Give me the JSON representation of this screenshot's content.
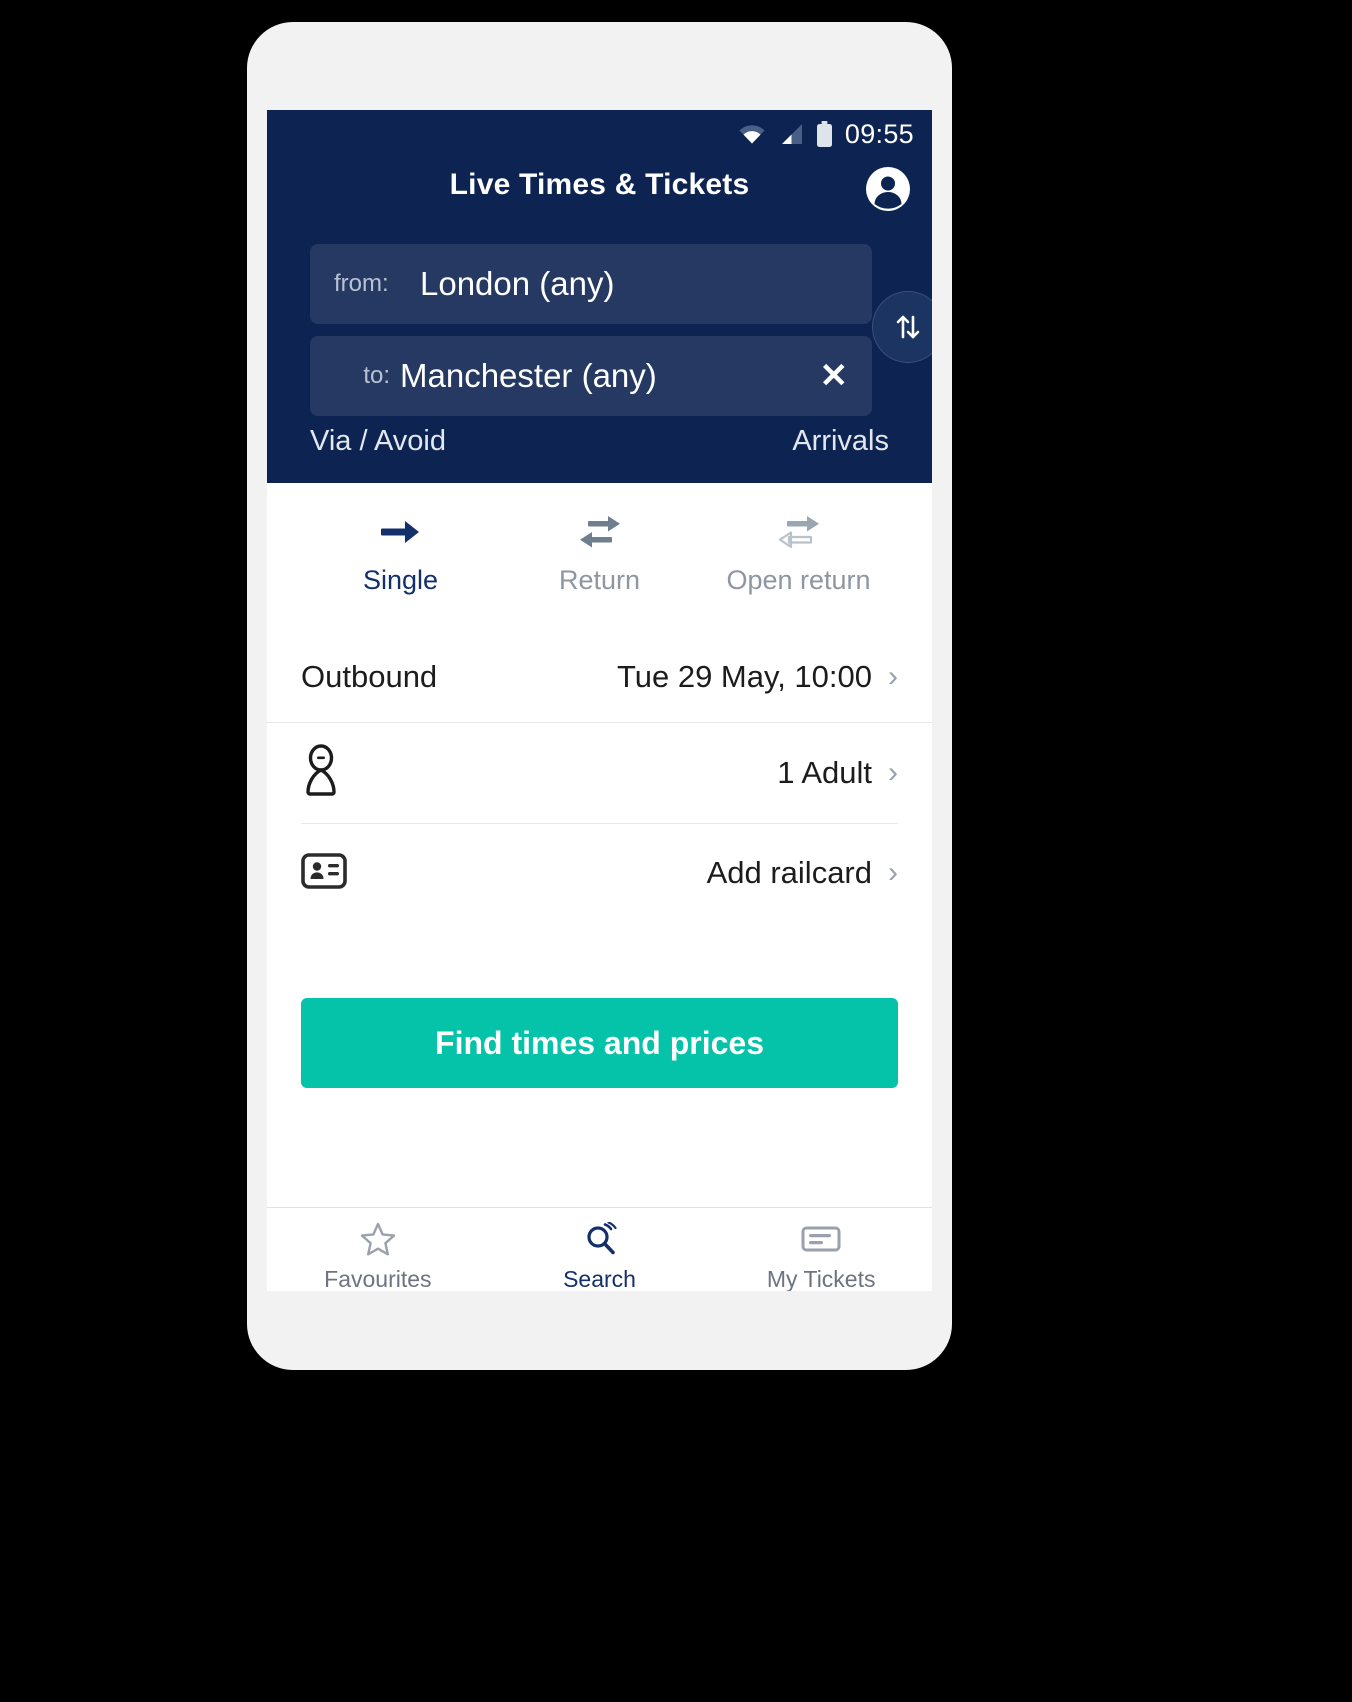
{
  "status_bar": {
    "time": "09:55",
    "wifi_icon": "wifi-icon",
    "signal_icon": "signal-icon",
    "battery_icon": "battery-icon"
  },
  "header": {
    "title": "Live Times & Tickets",
    "account_icon": "account-avatar-icon",
    "from": {
      "label": "from:",
      "value": "London (any)"
    },
    "to": {
      "label": "to:",
      "value": "Manchester (any)",
      "clear_icon": "✕"
    },
    "swap_icon": "swap-vertical-icon",
    "via_avoid": "Via / Avoid",
    "arrivals": "Arrivals",
    "background_color": "#0d2351"
  },
  "journey_tabs": [
    {
      "label": "Single",
      "icon": "arrow-right-icon",
      "active": true
    },
    {
      "label": "Return",
      "icon": "two-way-arrows-icon",
      "active": false
    },
    {
      "label": "Open return",
      "icon": "two-way-arrows-outline-icon",
      "active": false
    }
  ],
  "rows": {
    "outbound": {
      "label": "Outbound",
      "value": "Tue 29 May, 10:00",
      "chevron": "›"
    },
    "passengers": {
      "icon": "person-icon",
      "value": "1 Adult",
      "chevron": "›"
    },
    "railcard": {
      "icon": "railcard-id-icon",
      "value": "Add railcard",
      "chevron": "›"
    }
  },
  "cta": {
    "label": "Find times and prices",
    "color": "#05c3a8"
  },
  "bottom_nav": [
    {
      "label": "Favourites",
      "icon": "star-icon",
      "active": false
    },
    {
      "label": "Search",
      "icon": "search-icon",
      "active": true
    },
    {
      "label": "My Tickets",
      "icon": "ticket-icon",
      "active": false
    }
  ]
}
